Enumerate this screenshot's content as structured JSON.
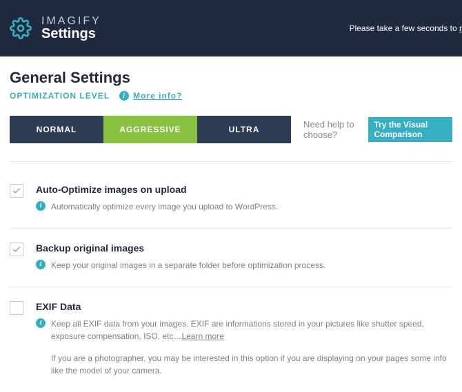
{
  "header": {
    "brand": "IMAGIFY",
    "subtitle": "Settings",
    "notice_prefix": "Please take a few seconds to ",
    "notice_link": "r"
  },
  "page": {
    "title": "General Settings",
    "subhead": "OPTIMIZATION LEVEL",
    "more_info": "More info?"
  },
  "levels": {
    "normal": "NORMAL",
    "aggressive": "AGGRESSIVE",
    "ultra": "ULTRA",
    "active": "aggressive",
    "help_text": "Need help to choose?",
    "visual_button": "Try the Visual Comparison"
  },
  "options": [
    {
      "key": "auto_optimize",
      "checked": true,
      "title": "Auto-Optimize images on upload",
      "desc": "Automatically optimize every image you upload to WordPress."
    },
    {
      "key": "backup",
      "checked": true,
      "title": "Backup original images",
      "desc": "Keep your original images in a separate folder before optimization process."
    },
    {
      "key": "exif",
      "checked": false,
      "title": "EXIF Data",
      "desc": "Keep all EXIF data from your images. EXIF are informations stored in your pictures like shutter speed, exposure compensation, ISO, etc…",
      "learn_more": "Learn more",
      "extra": "If you are a photographer, you may be interested in this option if you are displaying on your pages some info like the model of your camera."
    }
  ],
  "colors": {
    "accent": "#36afc2",
    "green": "#88c240",
    "dark": "#2d3b54",
    "header": "#1f2a3e"
  }
}
